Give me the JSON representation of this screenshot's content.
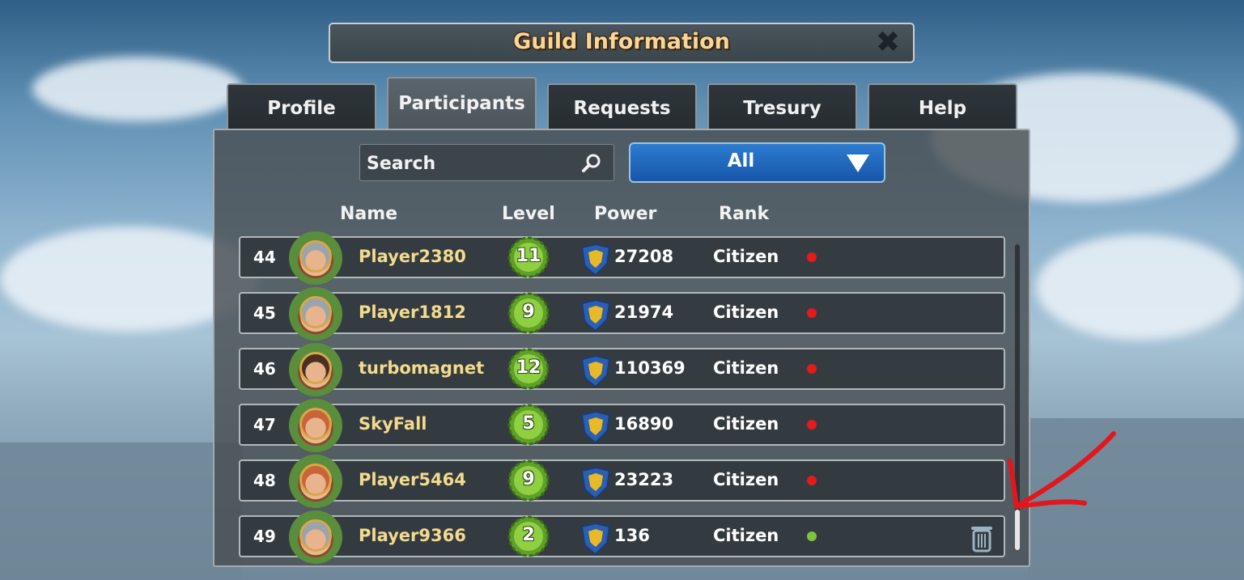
{
  "title": "Guild Information",
  "close_symbol": "✖",
  "tabs": [
    {
      "label": "Profile",
      "active": false
    },
    {
      "label": "Participants",
      "active": true
    },
    {
      "label": "Requests",
      "active": false
    },
    {
      "label": "Tresury",
      "active": false
    },
    {
      "label": "Help",
      "active": false
    }
  ],
  "search": {
    "placeholder": "Search",
    "icon": "search-icon"
  },
  "filter": {
    "selected": "All"
  },
  "columns": {
    "name": "Name",
    "level": "Level",
    "power": "Power",
    "rank": "Rank"
  },
  "participants": [
    {
      "number": "44",
      "name": "Player2380",
      "level": "11",
      "power": "27208",
      "rank": "Citizen",
      "online": false,
      "avatar": "knight"
    },
    {
      "number": "45",
      "name": "Player1812",
      "level": "9",
      "power": "21974",
      "rank": "Citizen",
      "online": false,
      "avatar": "knight"
    },
    {
      "number": "46",
      "name": "turbomagnet",
      "level": "12",
      "power": "110369",
      "rank": "Citizen",
      "online": false,
      "avatar": "woman"
    },
    {
      "number": "47",
      "name": "SkyFall",
      "level": "5",
      "power": "16890",
      "rank": "Citizen",
      "online": false,
      "avatar": "young-man"
    },
    {
      "number": "48",
      "name": "Player5464",
      "level": "9",
      "power": "23223",
      "rank": "Citizen",
      "online": false,
      "avatar": "young-man"
    },
    {
      "number": "49",
      "name": "Player9366",
      "level": "2",
      "power": "136",
      "rank": "Citizen",
      "online": true,
      "avatar": "knight"
    }
  ],
  "colors": {
    "online": "#7cc43a",
    "offline": "#e51a1a",
    "name": "#f3db8e",
    "title": "#f6d79a",
    "filter": "#1f66bf"
  }
}
